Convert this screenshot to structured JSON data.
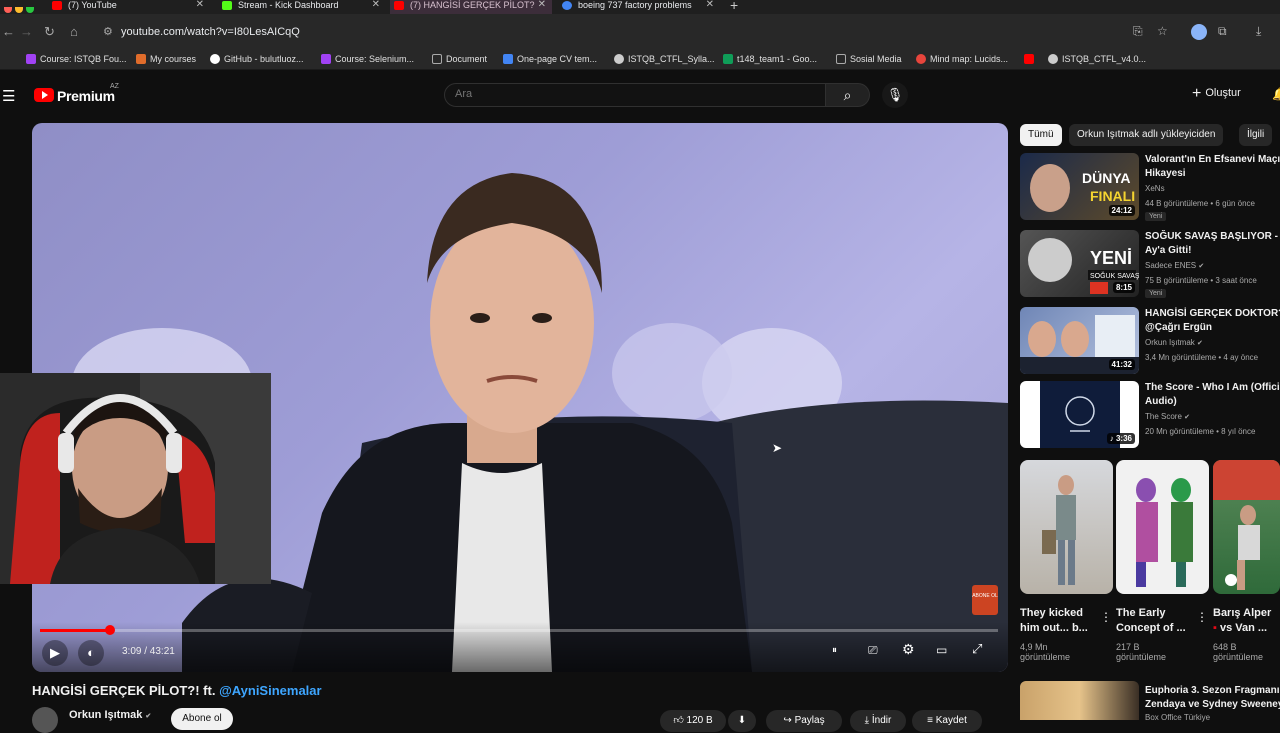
{
  "browser": {
    "tabs": [
      {
        "title": "(7) YouTube",
        "color": "#ff0000"
      },
      {
        "title": "Stream - Kick Dashboard",
        "color": "#53fc18"
      },
      {
        "title": "(7) HANGİSİ GERÇEK PİLOT?",
        "color": "#ff0000"
      },
      {
        "title": "boeing 737 factory problems",
        "color": "#4285f4"
      }
    ],
    "url": "youtube.com/watch?v=I80LesAICqQ",
    "bookmarks": [
      {
        "label": "Course: ISTQB Fou...",
        "color": "#a142f4"
      },
      {
        "label": "My courses",
        "color": "#e06c2b"
      },
      {
        "label": "GitHub - bulutluoz...",
        "color": "#ffffff"
      },
      {
        "label": "Course: Selenium...",
        "color": "#a142f4"
      },
      {
        "label": "Document",
        "color": "#888888"
      },
      {
        "label": "One-page CV tem...",
        "color": "#4285f4"
      },
      {
        "label": "ISTQB_CTFL_Sylla...",
        "color": "#cccccc"
      },
      {
        "label": "t148_team1 - Goo...",
        "color": "#0f9d58"
      },
      {
        "label": "Sosial Media",
        "color": "#888888"
      },
      {
        "label": "Mind map: Lucids...",
        "color": "#e8453c"
      },
      {
        "label": "ISTQB_CTFL_v4.0...",
        "color": "#cccccc"
      }
    ]
  },
  "youtube": {
    "logo_text": "Premium",
    "country_code": "AZ",
    "search_placeholder": "Ara",
    "create_label": "Oluştur"
  },
  "player": {
    "current_time": "3:09",
    "duration": "43:21",
    "progress": 0.073,
    "time_display": "3:09 / 43:21",
    "badge_text": "ABONE OL"
  },
  "video": {
    "title_main": "HANGİSİ GERÇEK PİLOT?! ft. ",
    "title_link": "@AyniSinemalar",
    "channel": "Orkun Işıtmak",
    "subscribe": "Abone ol",
    "like_count": "120 B",
    "actions": [
      "Paylaş",
      "İndir",
      "Kaydet"
    ]
  },
  "chips": [
    "Tümü",
    "Orkun Işıtmak adlı yükleyiciden",
    "İlgili"
  ],
  "recommendations": [
    {
      "title": "Valorant'ın En Efsanevi Maçının",
      "title2": "Hikayesi",
      "channel": "XeNs",
      "meta": "44 B görüntüleme • 6 gün önce",
      "badge": "Yeni",
      "duration": "24:12",
      "thumb_color": "#2e3a5a"
    },
    {
      "title": "SOĞUK SAVAŞ BAŞLIYOR - AB",
      "title2": "Ay'a Gitti!",
      "channel": "Sadece ENES",
      "meta": "75 B görüntüleme • 3 saat önce",
      "badge": "Yeni",
      "duration": "8:15",
      "thumb_color": "#4a4a4a"
    },
    {
      "title": "HANGİSİ GERÇEK DOKTOR?! ft.",
      "title2": "@Çağrı Ergün",
      "channel": "Orkun Işıtmak",
      "meta": "3,4 Mn görüntüleme • 4 ay önce",
      "badge": "",
      "duration": "41:32",
      "thumb_color": "#5a6f9a"
    },
    {
      "title": "The Score - Who I Am (Official",
      "title2": "Audio)",
      "channel": "The Score",
      "meta": "20 Mn görüntüleme • 8 yıl önce",
      "badge": "",
      "duration": "3:36",
      "thumb_color": "#0f1c3a"
    }
  ],
  "shorts": [
    {
      "title": "They kicked",
      "title2": "him out... b...",
      "views": "4,9 Mn",
      "views2": "görüntüleme"
    },
    {
      "title": "The Early",
      "title2": "Concept of ...",
      "views": "217 B",
      "views2": "görüntüleme"
    },
    {
      "title": "Barış Alper",
      "title2": "vs Van ...",
      "views": "648 B",
      "views2": "görüntüleme"
    }
  ],
  "bottom_rec": {
    "title": "Euphoria 3. Sezon Fragmanı |",
    "title2": "Zendaya ve Sydney Sweeney",
    "channel": "Box Office Türkiye"
  }
}
